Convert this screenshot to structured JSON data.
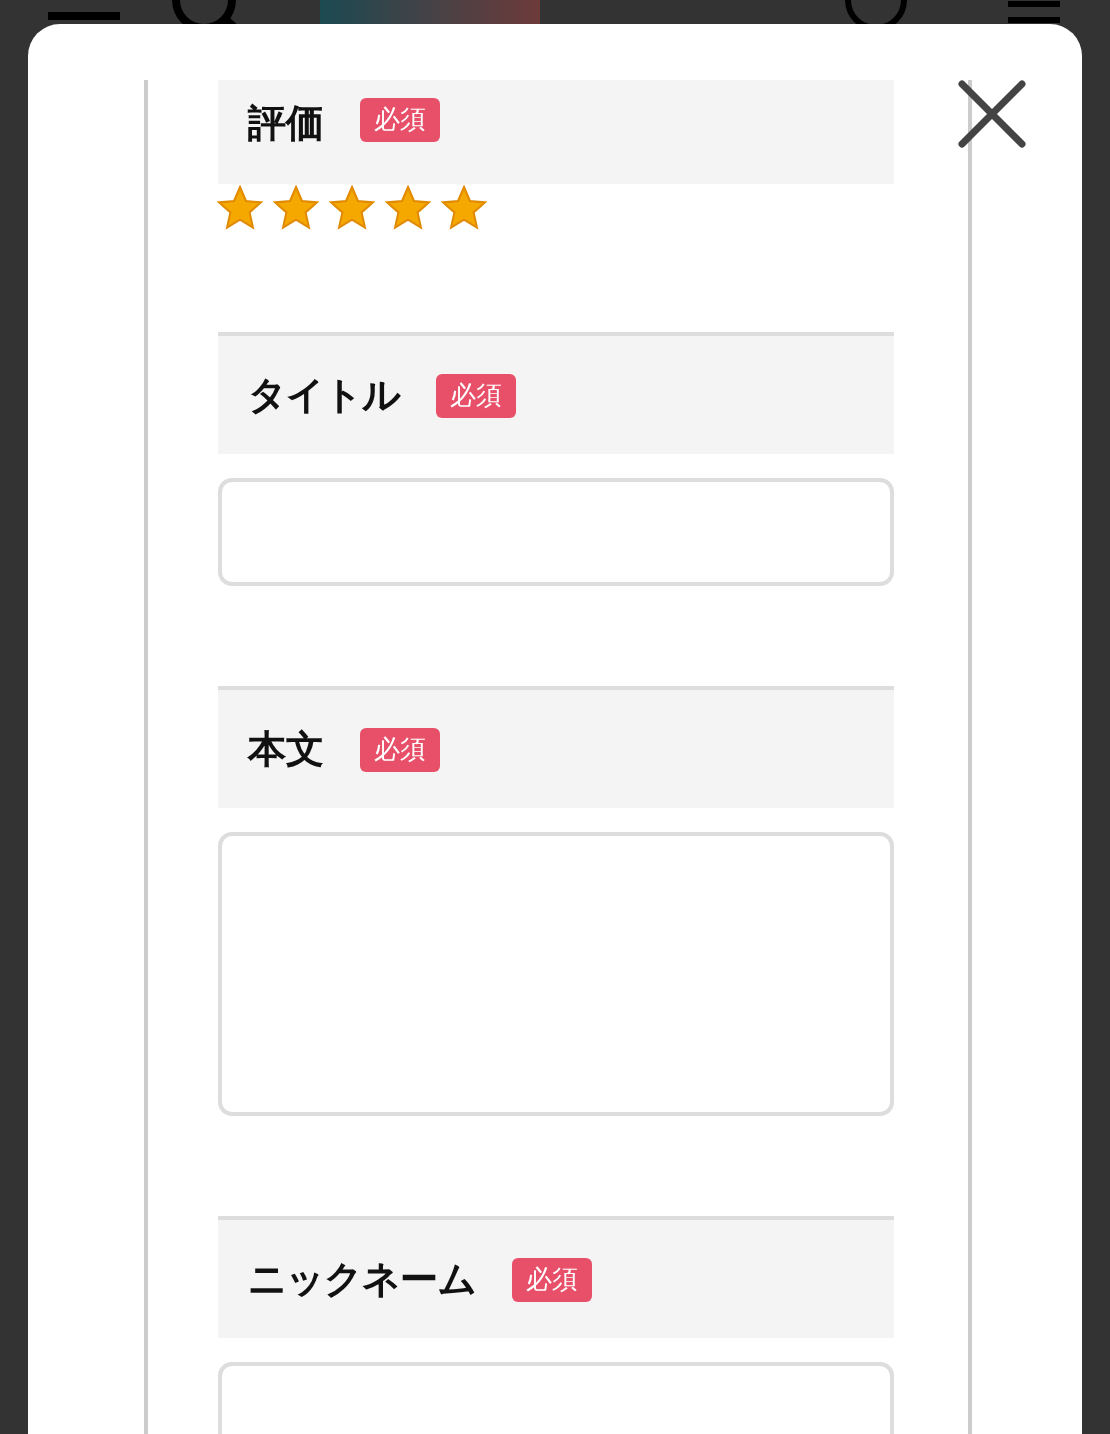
{
  "fields": [
    {
      "kind": "rating",
      "label": "評価",
      "badge": "必須",
      "stars": 5
    },
    {
      "kind": "text",
      "label": "タイトル",
      "badge": "必須"
    },
    {
      "kind": "textarea",
      "label": "本文",
      "badge": "必須"
    },
    {
      "kind": "text",
      "label": "ニックネーム",
      "badge": "必須"
    }
  ]
}
